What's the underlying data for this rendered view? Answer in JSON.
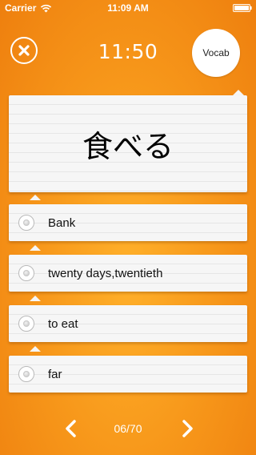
{
  "status_bar": {
    "carrier": "Carrier",
    "time": "11:09 AM"
  },
  "header": {
    "timer": "11:50",
    "badge": "Vocab"
  },
  "question": {
    "word": "食べる"
  },
  "answers": [
    {
      "label": "Bank"
    },
    {
      "label": "twenty days,twentieth"
    },
    {
      "label": "to eat"
    },
    {
      "label": "far"
    }
  ],
  "footer": {
    "page": "06/70"
  },
  "colors": {
    "background": "#f7971a",
    "card": "#f6f6f6",
    "text_light": "#ffffff"
  },
  "icons": {
    "close": "close-icon",
    "prev": "chevron-left-icon",
    "next": "chevron-right-icon",
    "wifi": "wifi-icon",
    "battery": "battery-icon"
  }
}
